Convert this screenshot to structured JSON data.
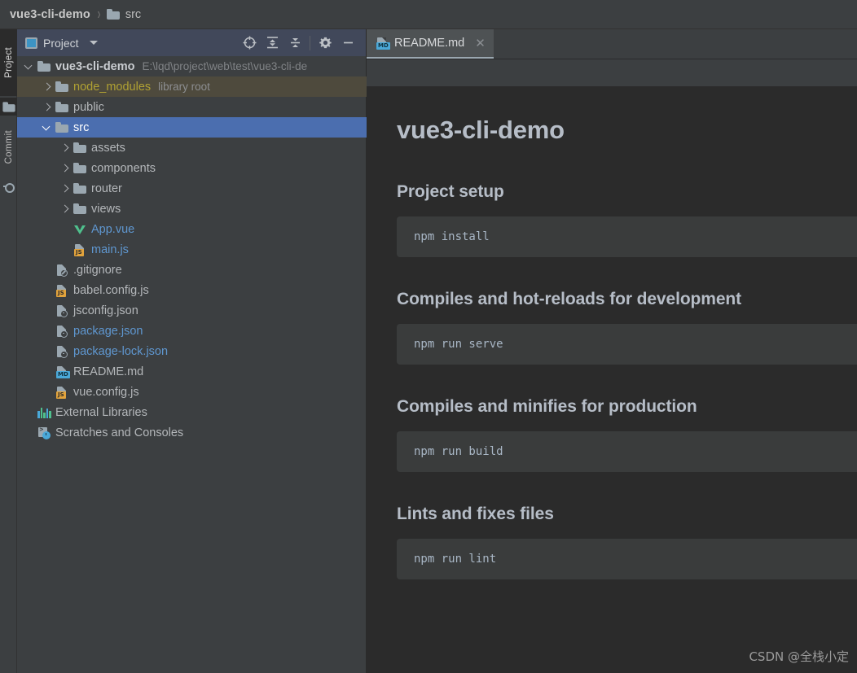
{
  "breadcrumb": {
    "root": "vue3-cli-demo",
    "separator": "›",
    "leaf": "src"
  },
  "toolstrip": {
    "project_label": "Project",
    "commit_label": "Commit"
  },
  "project_panel": {
    "title": "Project",
    "actions": [
      {
        "name": "select-opened-file-icon",
        "tooltip": "Select Opened File"
      },
      {
        "name": "expand-all-icon",
        "tooltip": "Expand All"
      },
      {
        "name": "collapse-all-icon",
        "tooltip": "Collapse All"
      },
      {
        "name": "gear-icon",
        "tooltip": "Options"
      },
      {
        "name": "minimize-icon",
        "tooltip": "Hide"
      }
    ],
    "tree": [
      {
        "label": "vue3-cli-demo",
        "sublabel": "E:\\lqd\\project\\web\\test\\vue3-cli-de",
        "indent": 0,
        "arrow": "down",
        "icon": "folder",
        "style": "bold"
      },
      {
        "label": "node_modules",
        "sublabel": "library root",
        "indent": 1,
        "arrow": "right",
        "icon": "folder",
        "style": "libroot"
      },
      {
        "label": "public",
        "sublabel": "",
        "indent": 1,
        "arrow": "right",
        "icon": "folder",
        "style": "plain"
      },
      {
        "label": "src",
        "sublabel": "",
        "indent": 1,
        "arrow": "down",
        "icon": "folder",
        "style": "selected"
      },
      {
        "label": "assets",
        "sublabel": "",
        "indent": 2,
        "arrow": "right",
        "icon": "folder",
        "style": "plain"
      },
      {
        "label": "components",
        "sublabel": "",
        "indent": 2,
        "arrow": "right",
        "icon": "folder",
        "style": "plain"
      },
      {
        "label": "router",
        "sublabel": "",
        "indent": 2,
        "arrow": "right",
        "icon": "folder",
        "style": "plain"
      },
      {
        "label": "views",
        "sublabel": "",
        "indent": 2,
        "arrow": "right",
        "icon": "folder",
        "style": "plain"
      },
      {
        "label": "App.vue",
        "sublabel": "",
        "indent": 2,
        "arrow": "none",
        "icon": "vue",
        "style": "vcs-blue"
      },
      {
        "label": "main.js",
        "sublabel": "",
        "indent": 2,
        "arrow": "none",
        "icon": "js",
        "style": "vcs-blue"
      },
      {
        "label": ".gitignore",
        "sublabel": "",
        "indent": 1,
        "arrow": "none",
        "icon": "ignore",
        "style": "plain"
      },
      {
        "label": "babel.config.js",
        "sublabel": "",
        "indent": 1,
        "arrow": "none",
        "icon": "js",
        "style": "plain"
      },
      {
        "label": "jsconfig.json",
        "sublabel": "",
        "indent": 1,
        "arrow": "none",
        "icon": "json",
        "style": "plain"
      },
      {
        "label": "package.json",
        "sublabel": "",
        "indent": 1,
        "arrow": "none",
        "icon": "json",
        "style": "vcs-blue"
      },
      {
        "label": "package-lock.json",
        "sublabel": "",
        "indent": 1,
        "arrow": "none",
        "icon": "json",
        "style": "vcs-blue"
      },
      {
        "label": "README.md",
        "sublabel": "",
        "indent": 1,
        "arrow": "none",
        "icon": "md",
        "style": "plain"
      },
      {
        "label": "vue.config.js",
        "sublabel": "",
        "indent": 1,
        "arrow": "none",
        "icon": "js",
        "style": "plain"
      },
      {
        "label": "External Libraries",
        "sublabel": "",
        "indent": 0,
        "arrow": "none",
        "icon": "libs",
        "style": "plain"
      },
      {
        "label": "Scratches and Consoles",
        "sublabel": "",
        "indent": 0,
        "arrow": "none",
        "icon": "scratch",
        "style": "plain"
      }
    ]
  },
  "editor": {
    "tabs": [
      {
        "label": "README.md",
        "icon": "md-file-icon",
        "close": "✕",
        "active": true
      }
    ]
  },
  "preview": {
    "blocks": [
      {
        "kind": "h1",
        "text": "vue3-cli-demo"
      },
      {
        "kind": "h2",
        "text": "Project setup"
      },
      {
        "kind": "code",
        "text": "npm install"
      },
      {
        "kind": "h2",
        "text": "Compiles and hot-reloads for development"
      },
      {
        "kind": "code",
        "text": "npm run serve"
      },
      {
        "kind": "h2",
        "text": "Compiles and minifies for production"
      },
      {
        "kind": "code",
        "text": "npm run build"
      },
      {
        "kind": "h2",
        "text": "Lints and fixes files"
      },
      {
        "kind": "code",
        "text": "npm run lint"
      }
    ]
  },
  "watermark": {
    "text": "CSDN @全栈小定"
  },
  "colors": {
    "panel_bg": "#3c3f41",
    "editor_bg": "#2b2b2b",
    "selection_blue": "#4b6eaf",
    "library_root_bg": "#4e4a3d",
    "library_root_text": "#b0a133",
    "vcs_blue_text": "#5f97d0",
    "code_block_bg": "#3a3c3c",
    "heading_text": "#b6bdc7",
    "tab_active_bg": "#4e5254",
    "panel_header_bg": "#41485a"
  }
}
